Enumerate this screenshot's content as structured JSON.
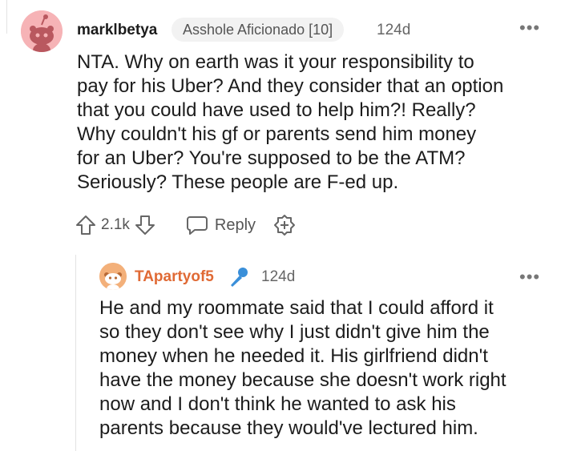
{
  "comment": {
    "username": "marklbetya",
    "flair": "Asshole Aficionado [10]",
    "age": "124d",
    "body": "NTA. Why on earth was it your responsibility to\npay for his Uber? And they consider that an option\nthat you could have used to help him?! Really?\nWhy couldn't his gf or parents send him money\nfor an Uber? You're supposed to be the ATM?\nSeriously? These people are F-ed up.",
    "votes": "2.1k",
    "reply_label": "Reply",
    "more": "•••"
  },
  "reply": {
    "username": "TApartyof5",
    "age": "124d",
    "body": "He and my roommate said that I could afford it\nso they don't see why I just didn't give him the\nmoney when he needed it. His girlfriend didn't\nhave the money because she doesn't work right\nnow and I don't think he wanted to ask his\nparents because they would've lectured him.",
    "more": "•••"
  },
  "colors": {
    "op_username": "#e06a35",
    "mic_blue": "#3a8fd9",
    "avatar_main_bg": "#f6b3b6",
    "avatar_reply_bg": "#f3b07a"
  },
  "icons": {
    "upvote": "upvote-arrow-icon",
    "downvote": "downvote-arrow-icon",
    "reply": "speech-bubble-icon",
    "award": "award-plus-icon",
    "mic": "microphone-icon",
    "more": "more-options-icon"
  }
}
